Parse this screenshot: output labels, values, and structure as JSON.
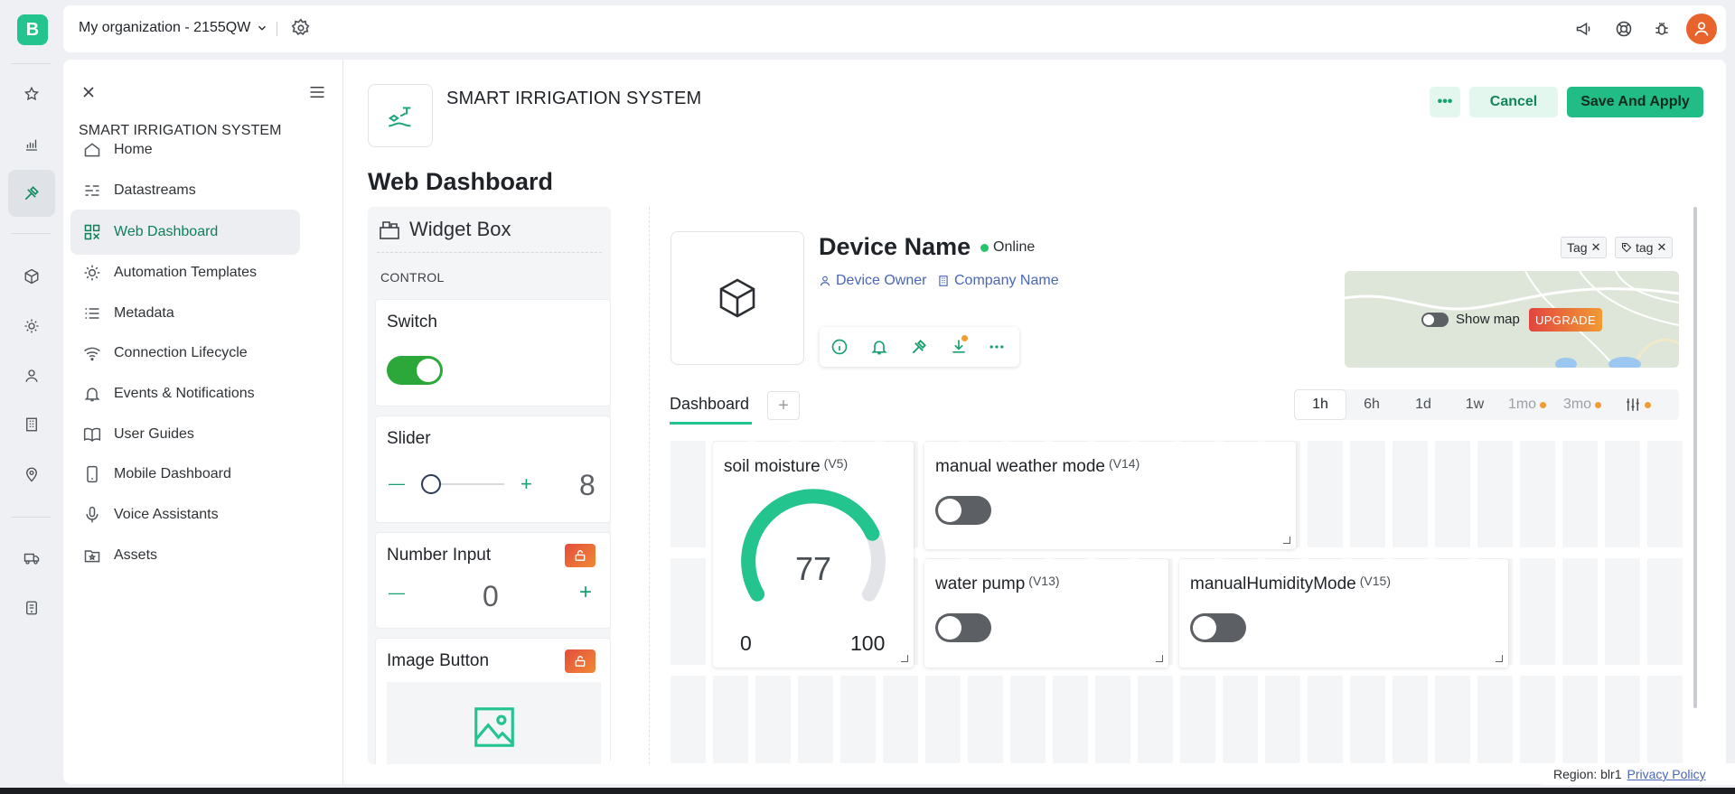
{
  "app": {
    "logo_letter": "B"
  },
  "topbar": {
    "org_name": "My organization - 2155QW"
  },
  "sidebar": {
    "template_title": "SMART IRRIGATION SYSTEM",
    "items": [
      {
        "label": "Home",
        "icon": "home-icon"
      },
      {
        "label": "Datastreams",
        "icon": "datastreams-icon"
      },
      {
        "label": "Web Dashboard",
        "icon": "web-dashboard-icon",
        "active": true
      },
      {
        "label": "Automation Templates",
        "icon": "automation-icon"
      },
      {
        "label": "Metadata",
        "icon": "metadata-icon"
      },
      {
        "label": "Connection Lifecycle",
        "icon": "wifi-icon"
      },
      {
        "label": "Events & Notifications",
        "icon": "bell-icon"
      },
      {
        "label": "User Guides",
        "icon": "book-icon"
      },
      {
        "label": "Mobile Dashboard",
        "icon": "mobile-icon"
      },
      {
        "label": "Voice Assistants",
        "icon": "microphone-icon"
      },
      {
        "label": "Assets",
        "icon": "assets-icon"
      }
    ]
  },
  "header": {
    "template_name": "SMART IRRIGATION SYSTEM",
    "more_label": "•••",
    "cancel_label": "Cancel",
    "save_label": "Save And Apply",
    "page_title": "Web Dashboard"
  },
  "widget_box": {
    "title": "Widget Box",
    "category": "CONTROL",
    "switch_title": "Switch",
    "slider_title": "Slider",
    "slider_value": "8",
    "slider_minus": "—",
    "slider_plus": "+",
    "number_title": "Number Input",
    "number_value": "0",
    "number_minus": "—",
    "number_plus": "+",
    "image_button_title": "Image Button"
  },
  "device": {
    "name": "Device Name",
    "status": "Online",
    "owner": "Device Owner",
    "company": "Company Name",
    "tags": [
      "Tag",
      "tag"
    ],
    "show_map": "Show map",
    "upgrade": "UPGRADE"
  },
  "tabs": {
    "dashboard": "Dashboard",
    "add": "+"
  },
  "time_range": [
    {
      "label": "1h",
      "active": true
    },
    {
      "label": "6h"
    },
    {
      "label": "1d"
    },
    {
      "label": "1w"
    },
    {
      "label": "1mo",
      "locked": true
    },
    {
      "label": "3mo",
      "locked": true
    }
  ],
  "widgets": {
    "soil": {
      "title": "soil moisture",
      "pin": "(V5)",
      "value": "77",
      "min": "0",
      "max": "100",
      "level": 0.77
    },
    "weather": {
      "title": "manual weather mode",
      "pin": "(V14)"
    },
    "pump": {
      "title": "water pump",
      "pin": "(V13)"
    },
    "humidity": {
      "title": "manualHumidityMode",
      "pin": "(V15)"
    }
  },
  "footer": {
    "region": "Region: blr1",
    "privacy": "Privacy Policy"
  },
  "colors": {
    "brand": "#23c48e",
    "accent_dark": "#13835c",
    "upgrade_from": "#e2453f",
    "upgrade_to": "#f29b33"
  }
}
